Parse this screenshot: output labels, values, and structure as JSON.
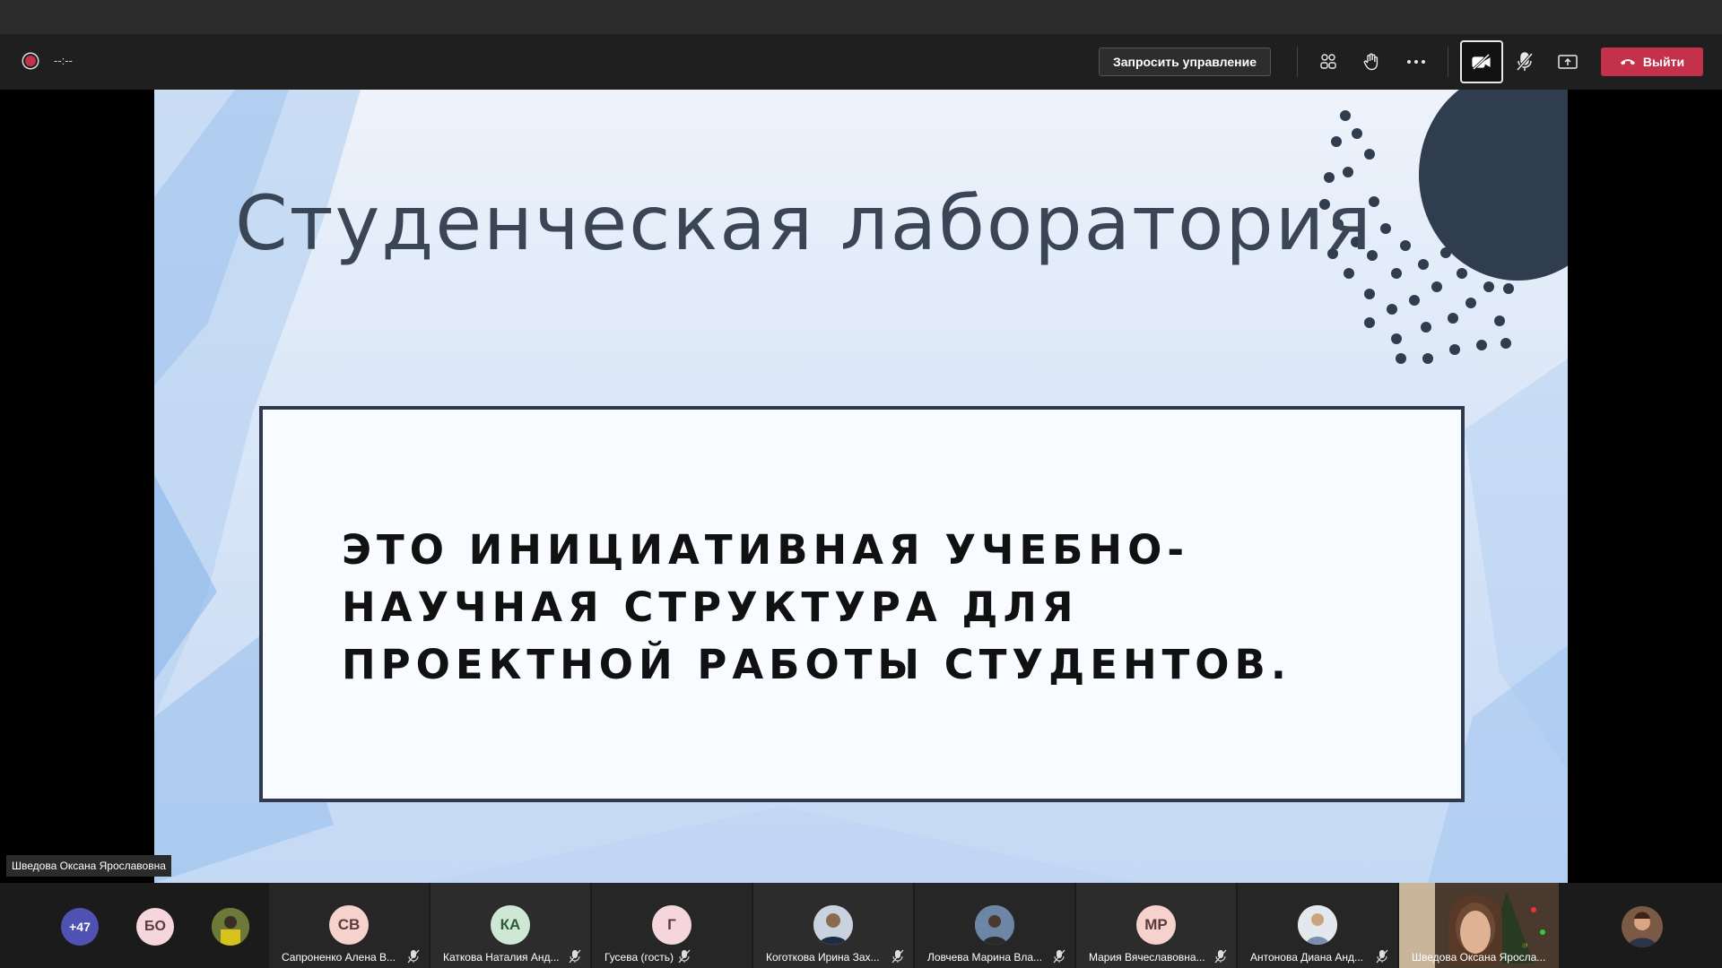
{
  "toolbar": {
    "timer": "--:--",
    "request_control": "Запросить управление",
    "leave": "Выйти"
  },
  "slide": {
    "title": "Студенческая  лаборатория",
    "body": "ЭТО ИНИЦИАТИВНАЯ УЧЕБНО-НАУЧНАЯ СТРУКТУРА ДЛЯ ПРОЕКТНОЙ РАБОТЫ СТУДЕНТОВ."
  },
  "presenter": {
    "name": "Шведова Оксана Ярославовна"
  },
  "overflow_count": "+47",
  "small_avatars": [
    {
      "initials": "БО",
      "color": "#f4d6dc"
    }
  ],
  "participants": [
    {
      "initials": "СВ",
      "name": "Сапроненко Алена В...",
      "avatar_color": "#f6d2cc"
    },
    {
      "initials": "КА",
      "name": "Каткова Наталия Анд...",
      "avatar_color": "#cfe8d6"
    },
    {
      "initials": "Г",
      "name": "Гусева (гость)",
      "avatar_color": "#f4d6dc"
    },
    {
      "initials": "",
      "name": "Коготкова Ирина Зах...",
      "avatar_color": "#9aa6b6"
    },
    {
      "initials": "",
      "name": "Ловчева Марина Вла...",
      "avatar_color": "#7d8a9c"
    },
    {
      "initials": "МР",
      "name": "Мария Вячеславовна...",
      "avatar_color": "#f6d2cc"
    },
    {
      "initials": "",
      "name": "Антонова Диана Анд...",
      "avatar_color": "#c8d0dc"
    },
    {
      "initials": "",
      "name": "Шведова Оксана Яросла...",
      "avatar_color": "#6b5a4c"
    }
  ],
  "icons": [
    "record-icon",
    "participants-icon",
    "raise-hand-icon",
    "more-icon",
    "camera-off-icon",
    "mic-off-icon",
    "share-icon",
    "phone-icon"
  ]
}
